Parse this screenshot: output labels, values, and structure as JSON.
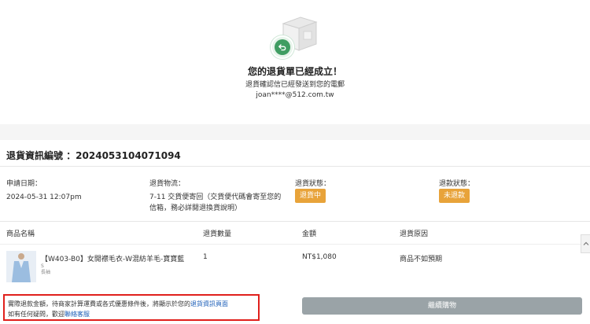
{
  "hero": {
    "title": "您的退貨單已經成立！",
    "subtitle": "退貨確認信已經發送到您的電郵",
    "email": "joan****@512.com.tw"
  },
  "return_info": {
    "title": "退貨資訊編號 ：2024053104071094",
    "apply_date_label": "申請日期：",
    "apply_date_value": "2024-05-31 12:07pm",
    "logistics_label": "退貨物流：",
    "logistics_value": "7-11 交貨便寄回（交貨便代碼會寄至您的信箱，務必詳閱退換貨說明）",
    "return_status_label": "退貨狀態：",
    "return_status_value": "退貨中",
    "refund_status_label": "退款狀態：",
    "refund_status_value": "未退款"
  },
  "table": {
    "headers": [
      "商品名稱",
      "退貨數量",
      "金額",
      "退貨原因"
    ],
    "rows": [
      {
        "name": "【W403-B0】女開襟毛衣-W混紡羊毛-寶寶藍",
        "size": "S",
        "color": "長袖",
        "qty": "1",
        "amount": "NT$1,080",
        "reason": "商品不如預期"
      }
    ]
  },
  "notice": {
    "line1_prefix": "實際退款金額，待商家計算運費或各式優惠條件後，將顯示於您的",
    "line1_link": "退貨資訊頁面",
    "line2_prefix": "如有任何疑問，歡迎",
    "line2_link": "聯絡客服"
  },
  "cta": {
    "label": "繼續購物"
  },
  "colors": {
    "badge": "#e8a33a",
    "accent_green": "#3f9d62",
    "link": "#1d5fb8",
    "notice_border": "#e0201c",
    "cta_bg": "#9aa3a7"
  },
  "icons": {
    "hero_box": "box-icon",
    "hero_return": "return-arrow-icon",
    "scroll": "chevron-up-icon"
  }
}
